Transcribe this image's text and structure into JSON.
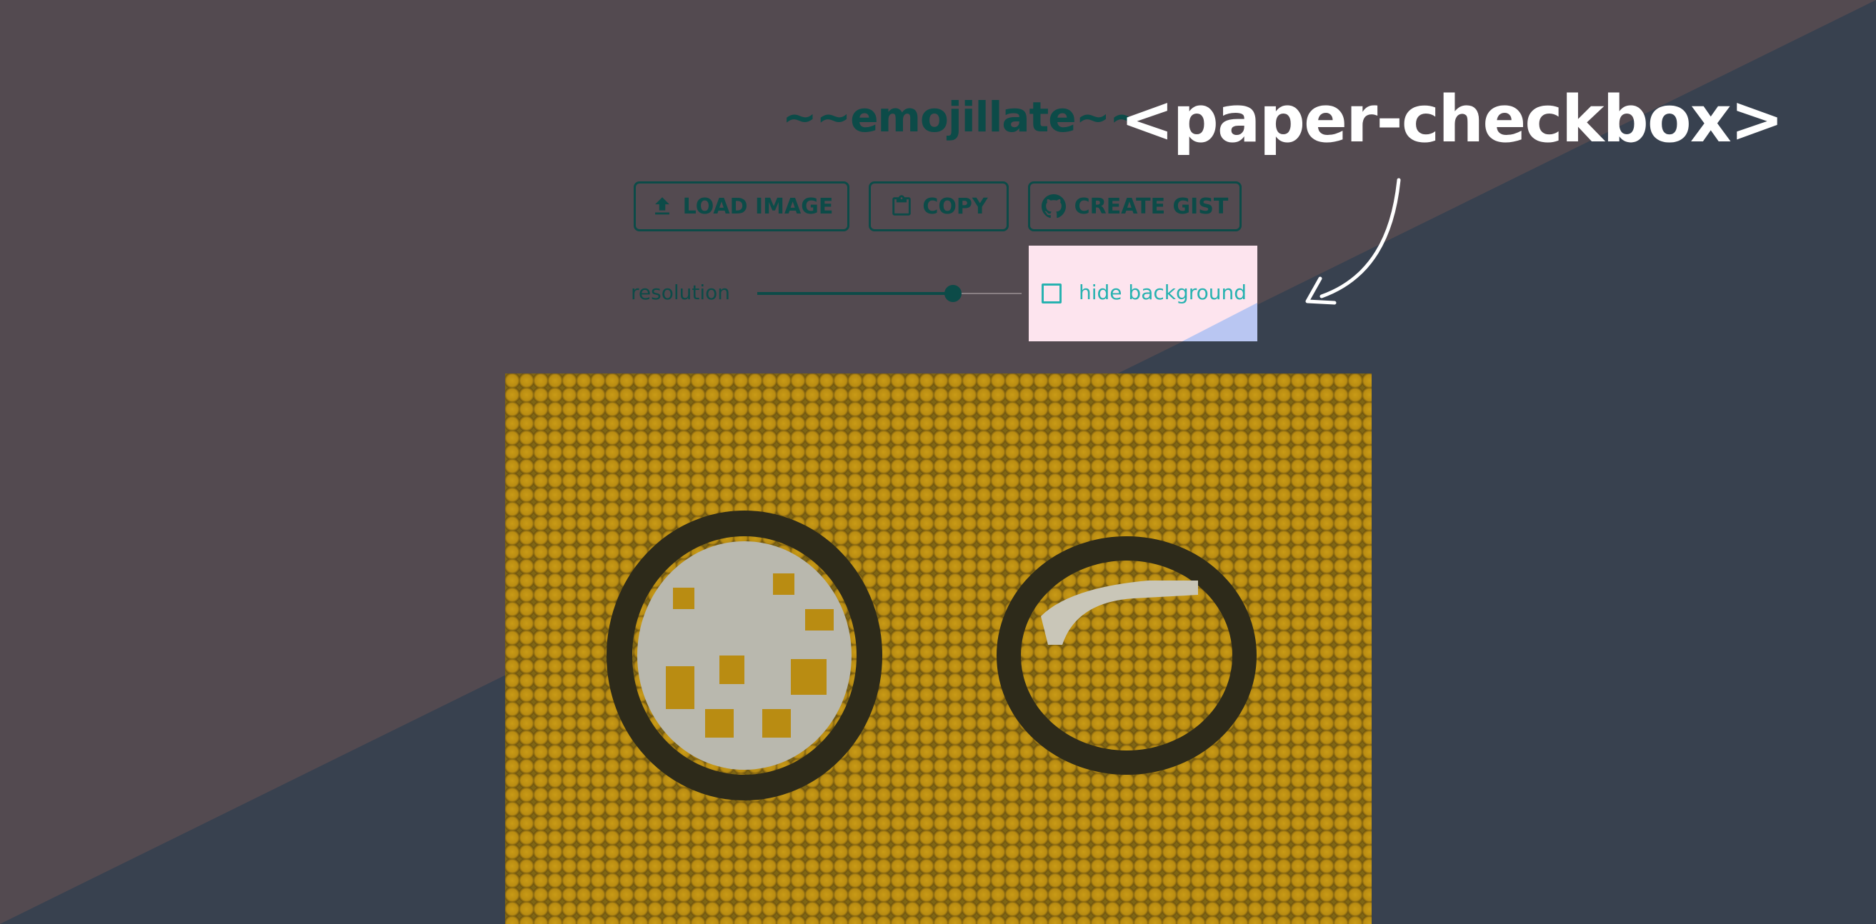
{
  "app": {
    "title": "~~emojillate~~",
    "component_label": "<paper-checkbox>"
  },
  "toolbar": {
    "load_label": "LOAD IMAGE",
    "copy_label": "COPY",
    "gist_label": "CREATE GIST"
  },
  "controls": {
    "resolution_label": "resolution",
    "resolution_value": 0.74,
    "hide_background_label": "hide background",
    "hide_background_checked": false
  },
  "colors": {
    "page_background": "#534a50",
    "diagonal_band": "#38414f",
    "primary": "#0c4b48",
    "checkbox_accent": "#27b2b0",
    "checkbox_card": "#fde4ee",
    "mosaic_gold": "#b98c12",
    "label_white": "#ffffff"
  },
  "icons": {
    "load": "upload-icon",
    "copy": "clipboard-icon",
    "gist": "github-icon",
    "arrow": "curved-arrow-icon"
  }
}
